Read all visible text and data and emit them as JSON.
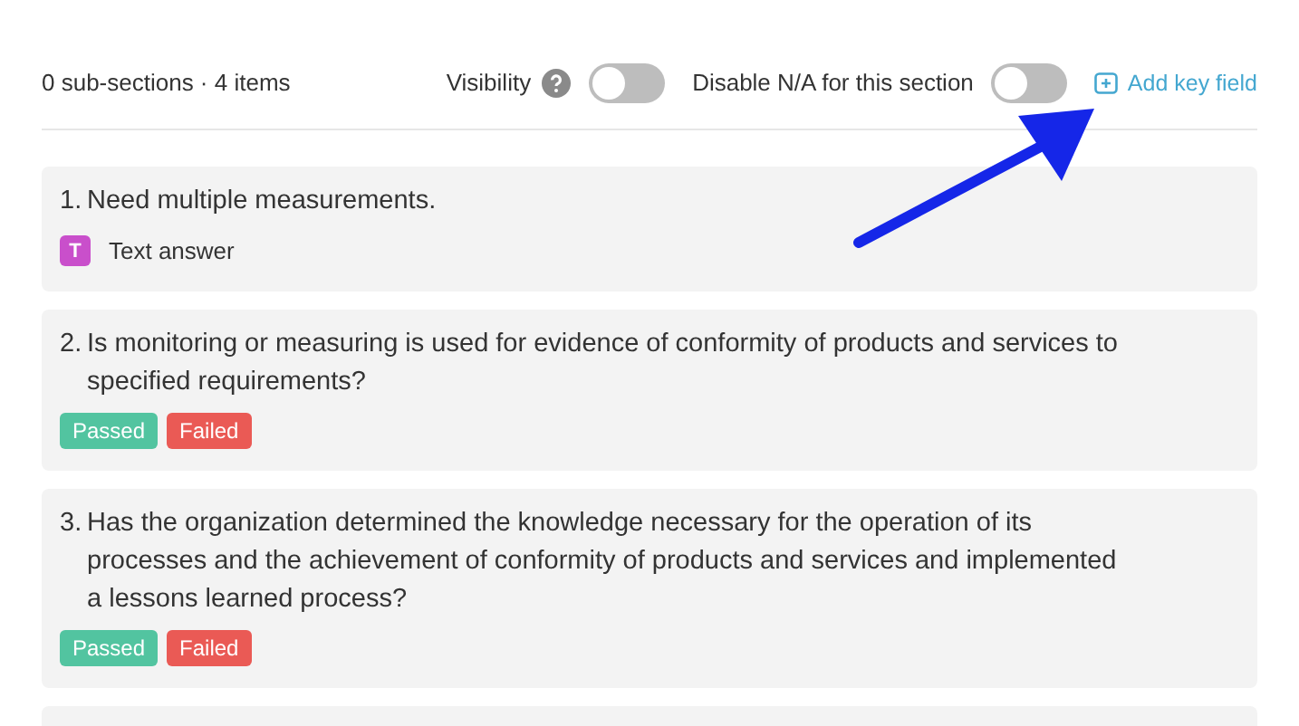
{
  "header": {
    "summary": "0 sub-sections · 4 items",
    "visibility": {
      "label": "Visibility",
      "on": false
    },
    "disable_na": {
      "label": "Disable N/A for this section",
      "on": false
    },
    "add_key_field": "Add key field"
  },
  "items": [
    {
      "number": "1.",
      "text": "Need multiple measurements.",
      "kind": "text",
      "answer_badge": "T",
      "answer_label": "Text answer"
    },
    {
      "number": "2.",
      "text": "Is monitoring or measuring is used for evidence of conformity of products and services to specified requirements?",
      "kind": "choices",
      "options": [
        {
          "label": "Passed",
          "color": "#52c4a0"
        },
        {
          "label": "Failed",
          "color": "#ea5a55"
        }
      ]
    },
    {
      "number": "3.",
      "text": "Has the organization determined the knowledge necessary for the operation of its processes and the achievement of conformity of products and services and implemented a lessons learned process?",
      "kind": "choices",
      "options": [
        {
          "label": "Passed",
          "color": "#52c4a0"
        },
        {
          "label": "Failed",
          "color": "#ea5a55"
        }
      ]
    }
  ]
}
